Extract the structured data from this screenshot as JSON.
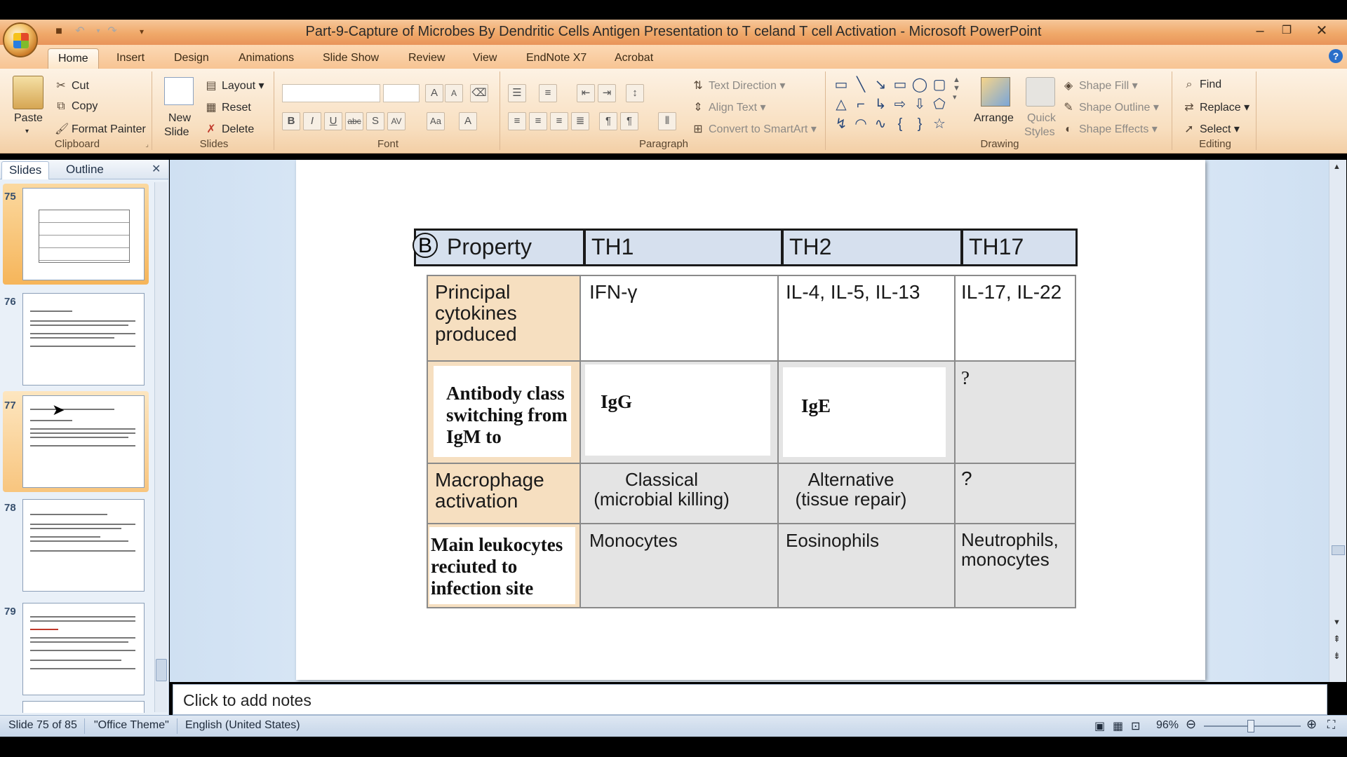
{
  "window": {
    "title": "Part-9-Capture of Microbes By Dendritic Cells  Antigen Presentation to T celand T cell Activation - Microsoft PowerPoint"
  },
  "ribbon_tabs": [
    "Home",
    "Insert",
    "Design",
    "Animations",
    "Slide Show",
    "Review",
    "View",
    "EndNote X7",
    "Acrobat"
  ],
  "clipboard": {
    "paste": "Paste",
    "cut": "Cut",
    "copy": "Copy",
    "format_painter": "Format Painter",
    "label": "Clipboard"
  },
  "slides_group": {
    "new_slide": "New",
    "new_slide2": "Slide",
    "layout": "Layout",
    "reset": "Reset",
    "delete": "Delete",
    "label": "Slides"
  },
  "font_group": {
    "label": "Font"
  },
  "paragraph_group": {
    "text_direction": "Text Direction",
    "align_text": "Align Text",
    "convert_smartart": "Convert to SmartArt",
    "label": "Paragraph"
  },
  "drawing_group": {
    "arrange": "Arrange",
    "quick": "Quick",
    "styles": "Styles",
    "shape_fill": "Shape Fill",
    "shape_outline": "Shape Outline",
    "shape_effects": "Shape Effects",
    "label": "Drawing"
  },
  "editing_group": {
    "find": "Find",
    "replace": "Replace",
    "select": "Select",
    "label": "Editing"
  },
  "panel_tabs": {
    "slides": "Slides",
    "outline": "Outline"
  },
  "thumbnails": [
    {
      "num": "75",
      "selected": true
    },
    {
      "num": "76",
      "selected": false
    },
    {
      "num": "77",
      "selected": false,
      "hover": true
    },
    {
      "num": "78",
      "selected": false
    },
    {
      "num": "79",
      "selected": false
    }
  ],
  "slide_table": {
    "badge": "B",
    "headers": [
      "Property",
      "TH1",
      "TH2",
      "TH17"
    ],
    "rows": [
      {
        "property": [
          "Principal",
          "cytokines",
          "produced"
        ],
        "th1": "IFN-γ",
        "th2": "IL-4, IL-5, IL-13",
        "th17": "IL-17, IL-22"
      },
      {
        "property": [
          "Antibody class",
          "switching from",
          "IgM to"
        ],
        "th1": "IgG",
        "th2": "IgE",
        "th17": "?"
      },
      {
        "property": [
          "Macrophage",
          "activation"
        ],
        "th1": [
          "Classical",
          "(microbial killing)"
        ],
        "th2": [
          "Alternative",
          "(tissue repair)"
        ],
        "th17": "?"
      },
      {
        "property": [
          "Main leukocytes",
          "reciuted to",
          "infection site"
        ],
        "th1": "Monocytes",
        "th2": "Eosinophils",
        "th17": [
          "Neutrophils,",
          "monocytes"
        ]
      }
    ]
  },
  "notes": {
    "placeholder": "Click to add notes"
  },
  "status": {
    "slide": "Slide 75 of 85",
    "theme": "\"Office Theme\"",
    "language": "English (United States)",
    "zoom": "96%"
  },
  "colors": {
    "accent": "#f6b55a",
    "header_fill": "#d6e0ee",
    "property_fill": "#f6dfc0"
  }
}
